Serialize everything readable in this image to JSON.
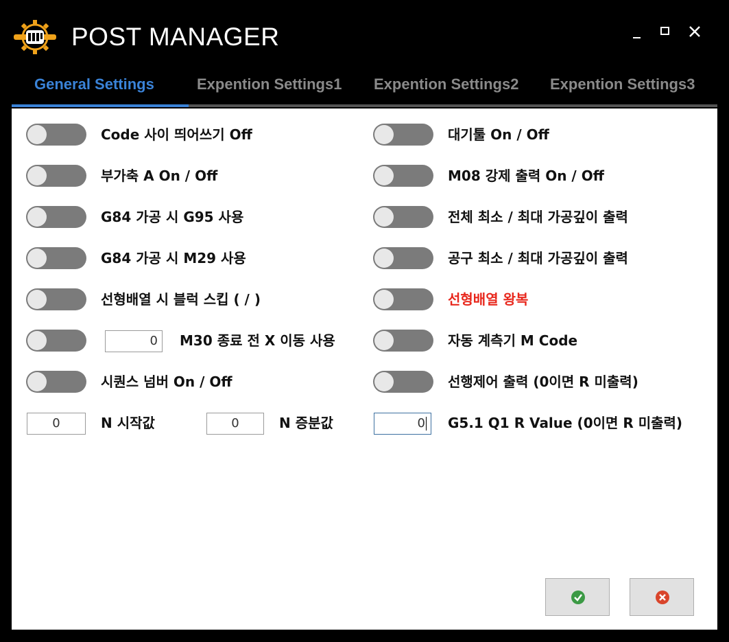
{
  "app": {
    "title": "POST MANAGER"
  },
  "tabs": [
    {
      "label": "General Settings",
      "active": true
    },
    {
      "label": "Expention Settings1",
      "active": false
    },
    {
      "label": "Expention Settings2",
      "active": false
    },
    {
      "label": "Expention Settings3",
      "active": false
    }
  ],
  "left_options": [
    {
      "label": "Code 사이 띄어쓰기 Off",
      "on": false
    },
    {
      "label": "부가축 A On / Off",
      "on": false
    },
    {
      "label": "G84 가공 시 G95 사용",
      "on": false
    },
    {
      "label": "G84 가공 시 M29 사용",
      "on": false
    },
    {
      "label": "선형배열 시 블럭 스킵 ( / )",
      "on": false
    },
    {
      "label": "M30 종료 전 X 이동 사용",
      "on": false,
      "value": "0"
    },
    {
      "label": "시퀀스 넘버 On / Off",
      "on": false
    }
  ],
  "right_options": [
    {
      "label": "대기툴 On / Off",
      "on": false
    },
    {
      "label": "M08 강제 출력 On / Off",
      "on": false
    },
    {
      "label": "전체 최소 / 최대 가공깊이 출력",
      "on": false
    },
    {
      "label": "공구 최소 / 최대 가공깊이 출력",
      "on": false
    },
    {
      "label": "선형배열 왕복",
      "on": false,
      "highlight_color": "#e8271c"
    },
    {
      "label": "자동 계측기 M Code",
      "on": false
    },
    {
      "label": "선행제어 출력 (0이면 R 미출력)",
      "on": false
    }
  ],
  "numeric_fields": {
    "n_start": {
      "label": "N 시작값",
      "value": "0"
    },
    "n_increment": {
      "label": "N 증분값",
      "value": "0"
    },
    "g51_q1": {
      "label": "G5.1 Q1 R Value (0이면 R 미출력)",
      "value": "0"
    }
  },
  "buttons": {
    "ok_icon": "check-circle-icon",
    "cancel_icon": "x-circle-icon"
  },
  "colors": {
    "accent": "#3a83d8",
    "toggle_off": "#7b7b7b",
    "ok": "#3c9a45",
    "cancel": "#d9452b"
  }
}
